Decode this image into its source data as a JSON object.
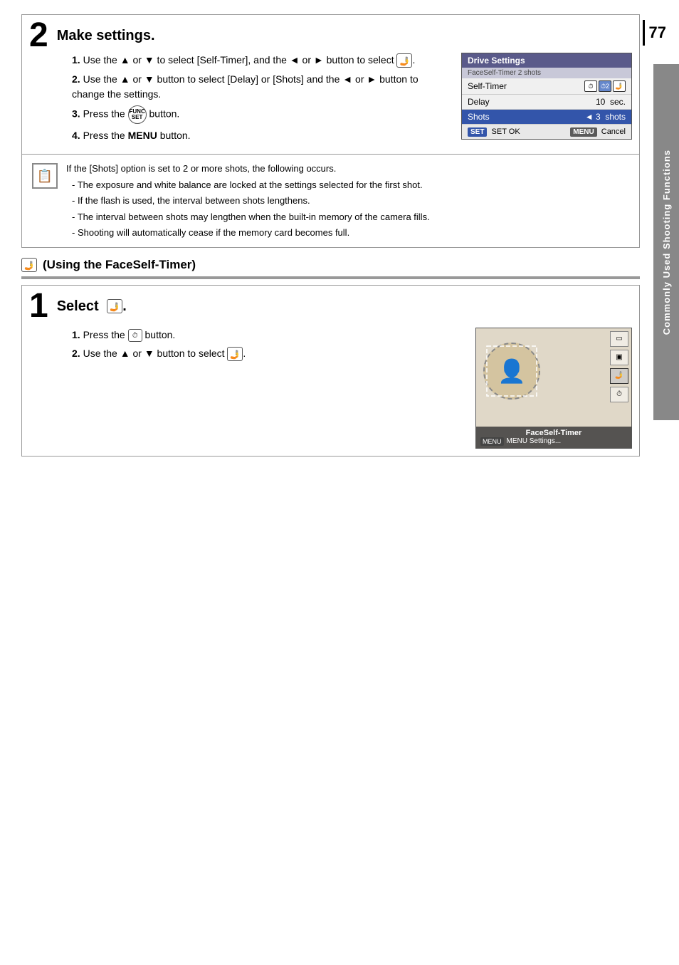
{
  "page": {
    "number": "77",
    "sidebar_label": "Commonly Used Shooting Functions"
  },
  "section2": {
    "step_number": "2",
    "title": "Make settings.",
    "steps": [
      {
        "num": "1.",
        "text": "Use the",
        "icons": [
          "up-arrow",
          "or",
          "down-arrow"
        ],
        "rest": "to select [Self-Timer], and the",
        "icons2": [
          "left-arrow",
          "or",
          "right-arrow"
        ],
        "rest2": "button to select",
        "icon_end": "face-self-timer-icon"
      },
      {
        "num": "2.",
        "text": "Use the",
        "icons": [
          "up-arrow",
          "or",
          "down-arrow"
        ],
        "rest": "button to select [Delay] or [Shots] and the",
        "icons2": [
          "left-arrow",
          "or",
          "right-arrow"
        ],
        "rest2": "button to change the settings."
      },
      {
        "num": "3.",
        "text": "Press the",
        "icon": "func-set-button",
        "rest": "button."
      },
      {
        "num": "4.",
        "text": "Press the",
        "bold": "MENU",
        "rest": "button."
      }
    ],
    "camera_screen": {
      "header": "Drive Settings",
      "subrow": "FaceSelf-Timer  2 shots",
      "rows": [
        {
          "label": "Self-Timer",
          "value": "timer-icons",
          "selected": false
        },
        {
          "label": "Delay",
          "value": "10  sec.",
          "selected": false
        },
        {
          "label": "Shots",
          "value": "◄ 3  shots",
          "selected": true
        }
      ],
      "footer_ok": "SET OK",
      "footer_cancel": "MENU Cancel"
    }
  },
  "note": {
    "text": "If the [Shots] option is set to 2 or more shots, the following occurs.",
    "bullets": [
      "The exposure and white balance are locked at the settings selected for the first shot.",
      "If the flash is used, the interval between shots lengthens.",
      "The interval between shots may lengthen when the built-in memory of the camera fills.",
      "Shooting will automatically cease if the memory card becomes full."
    ]
  },
  "face_section": {
    "icon": "🤳",
    "title": "(Using the FaceSelf-Timer)"
  },
  "section1": {
    "step_number": "1",
    "title": "Select",
    "icon": "face-self-timer",
    "steps": [
      {
        "num": "1.",
        "text": "Press the",
        "icon": "self-timer-button",
        "rest": "button."
      },
      {
        "num": "2.",
        "text": "Use the",
        "icons": [
          "up-arrow",
          "or",
          "down-arrow"
        ],
        "rest": "button to select",
        "icon_end": "face-self-timer-small"
      }
    ],
    "camera_screen": {
      "face_label": "FaceSelf-Timer",
      "menu_label": "MENU Settings..."
    }
  }
}
